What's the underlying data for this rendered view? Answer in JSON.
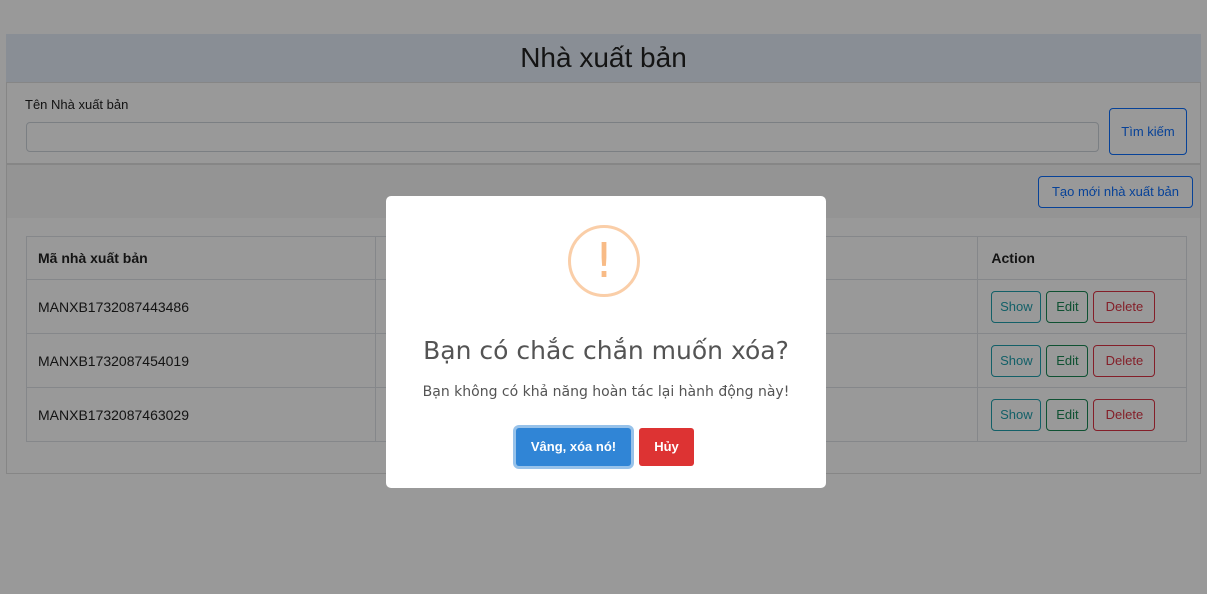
{
  "page": {
    "title": "Nhà xuất bản"
  },
  "search": {
    "label": "Tên Nhà xuất bản",
    "value": "",
    "button_label": "Tìm kiếm"
  },
  "toolbar": {
    "create_label": "Tạo mới nhà xuất bản"
  },
  "table": {
    "headers": [
      "Mã nhà xuất bản",
      "",
      "Action"
    ],
    "rows": [
      {
        "code": "MANXB1732087443486"
      },
      {
        "code": "MANXB1732087454019"
      },
      {
        "code": "MANXB1732087463029"
      }
    ],
    "actions": {
      "show": "Show",
      "edit": "Edit",
      "delete": "Delete"
    }
  },
  "dialog": {
    "icon": "!",
    "icon_name": "warning-icon",
    "title": "Bạn có chắc chắn muốn xóa?",
    "text": "Bạn không có khả năng hoàn tác lại hành động này!",
    "confirm_label": "Vâng, xóa nó!",
    "cancel_label": "Hủy"
  },
  "colors": {
    "primary": "#0d6efd",
    "info": "#20a0ae",
    "success": "#198754",
    "danger": "#dc3545",
    "confirm": "#3085d6",
    "cancel": "#dd3333",
    "warning": "#f8bb86"
  }
}
